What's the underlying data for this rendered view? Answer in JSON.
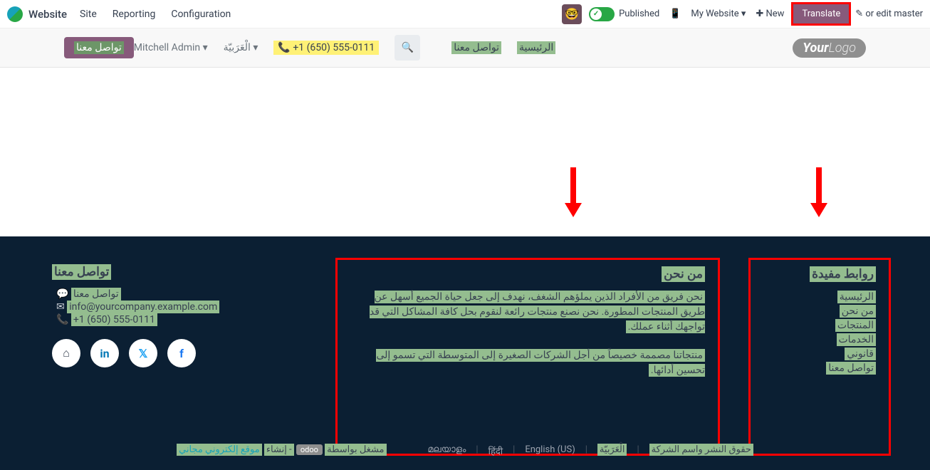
{
  "top": {
    "app": "Website",
    "site": "Site",
    "reporting": "Reporting",
    "config": "Configuration",
    "published": "Published",
    "mysite": "My Website",
    "new": "New",
    "translate": "Translate",
    "edit": "or edit master"
  },
  "header": {
    "home": "الرئيسية",
    "contact": "تواصل معنا",
    "phone": "+1 (650) 555-0111",
    "lang": "الْعَرَبيّة",
    "admin": "Mitchell Admin",
    "contactbtn": "تواصل معنا"
  },
  "footer": {
    "links_title": "روابط مفيدة",
    "links": [
      "الرئيسية",
      "من نحن",
      "المنتجات",
      "الخدمات",
      "قانوني",
      "تواصل معنا"
    ],
    "about_title": "من نحن",
    "about_p1": "نحن فريق من الأفراد الذين يملؤهم الشغف، نهدف إلى جعل حياة الجميع أسهل عن طريق المنتجات المطورة. نحن نصنع منتجات رائعة لنقوم بحل كافة المشاكل التي قد تواجهك أثناء عملك.",
    "about_p2": "منتجاتنا مصممة خصيصاً من أجل الشركات الصغيرة إلى المتوسطة التي تسمو إلى تحسين أدائها.",
    "contact_title": "تواصل معنا",
    "contact_us": "تواصل معنا",
    "email": "info@yourcompany.example.com",
    "phone": "+1 (650) 555-0111"
  },
  "bottom": {
    "copyright": "حقوق النشر واسم الشركة",
    "ar": "الْعَرَبيّة",
    "en": "English (US)",
    "hi": "हिंदी",
    "ml": "മലയാളം",
    "powered": "مشغل بواسطة",
    "create": "- إنشاء",
    "free": "موقع إلكتروني مجاني"
  }
}
